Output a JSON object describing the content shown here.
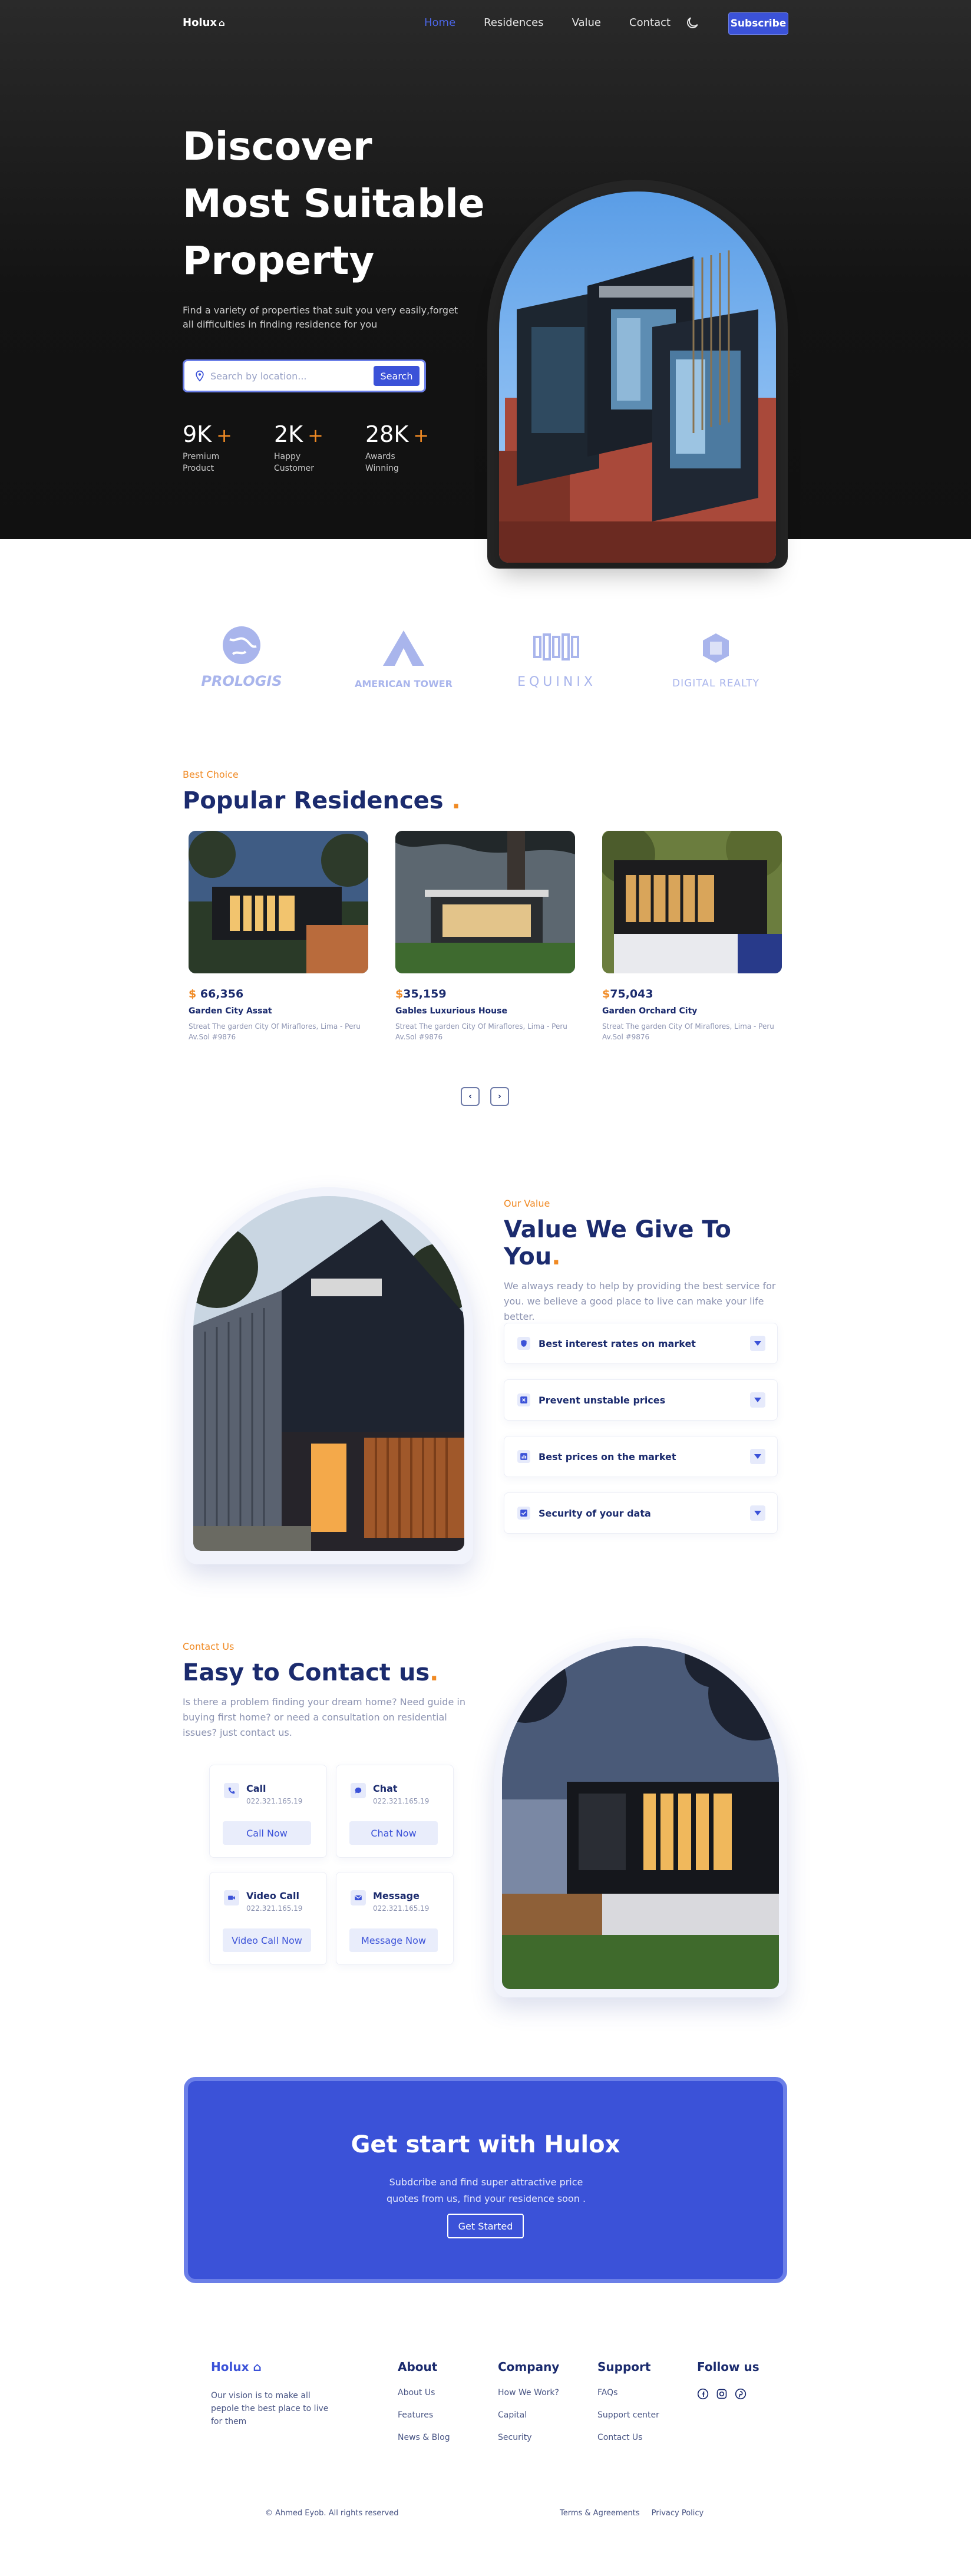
{
  "nav": {
    "logo": "Holux",
    "links": [
      "Home",
      "Residences",
      "Value",
      "Contact"
    ],
    "subscribe": "Subscribe"
  },
  "hero": {
    "title_lines": [
      "Discover",
      "Most Suitable",
      "Property"
    ],
    "subtitle": "Find a variety of properties that suit you very easily,forget all difficulties in finding residence for you",
    "search_placeholder": "Search by location...",
    "search_button": "Search",
    "stats": [
      {
        "value": "9K",
        "label": "Premium Product"
      },
      {
        "value": "2K",
        "label": "Happy Customer"
      },
      {
        "value": "28K",
        "label": "Awards Winning"
      }
    ],
    "plus": "+"
  },
  "partners": [
    "PROLOGIS",
    "AMERICAN TOWER",
    "EQUINIX",
    "DIGITAL REALTY"
  ],
  "popular": {
    "eyebrow": "Best Choice",
    "title": "Popular Residences",
    "title_dot": ".",
    "cards": [
      {
        "currency": "$",
        "price": "66,356",
        "name": "Garden City Assat",
        "address": "Streat The garden City Of Miraflores, Lima - Peru Av.Sol #9876"
      },
      {
        "currency": "$",
        "price": "35,159",
        "name": "Gables Luxurious House",
        "address": "Streat The garden City Of Miraflores, Lima - Peru Av.Sol #9876"
      },
      {
        "currency": "$",
        "price": "75,043",
        "name": "Garden Orchard City",
        "address": "Streat The garden City Of Miraflores, Lima - Peru Av.Sol #9876"
      }
    ],
    "prev": "‹",
    "next": "›"
  },
  "value": {
    "eyebrow": "Our Value",
    "title": "Value We Give To You",
    "title_dot": ".",
    "description": "We always ready to help by providing the best service for you. we believe a good place to live can make your life better.",
    "items": [
      {
        "label": "Best interest rates on market",
        "icon": "shield-icon"
      },
      {
        "label": "Prevent unstable prices",
        "icon": "cancel-icon"
      },
      {
        "label": "Best prices on the market",
        "icon": "analytics-icon"
      },
      {
        "label": "Security of your data",
        "icon": "check-icon"
      }
    ]
  },
  "contact": {
    "eyebrow": "Contact Us",
    "title": "Easy to Contact us",
    "title_dot": ".",
    "description": "Is there a problem finding your dream home? Need guide in buying first home? or need a consultation on residential issues? just contact us.",
    "cards": [
      {
        "title": "Call",
        "number": "022.321.165.19",
        "button": "Call Now",
        "icon": "phone-icon"
      },
      {
        "title": "Chat",
        "number": "022.321.165.19",
        "button": "Chat Now",
        "icon": "chat-icon"
      },
      {
        "title": "Video Call",
        "number": "022.321.165.19",
        "button": "Video Call Now",
        "icon": "video-icon"
      },
      {
        "title": "Message",
        "number": "022.321.165.19",
        "button": "Message Now",
        "icon": "mail-icon"
      }
    ]
  },
  "cta": {
    "title": "Get start with Hulox",
    "subtitle": "Subdcribe and find super attractive price quotes from us, find your residence soon .",
    "button": "Get Started"
  },
  "footer": {
    "logo": "Holux",
    "tagline": "Our vision is to make all pepole the best place to live for them",
    "columns": [
      {
        "title": "About",
        "links": [
          "About Us",
          "Features",
          "News & Blog"
        ]
      },
      {
        "title": "Company",
        "links": [
          "How We Work?",
          "Capital",
          "Security"
        ]
      },
      {
        "title": "Support",
        "links": [
          "FAQs",
          "Support center",
          "Contact Us"
        ]
      }
    ],
    "follow_title": "Follow us",
    "copyright": "© Ahmed Eyob. All rights reserved",
    "legal": [
      "Terms & Agreements",
      "Privacy Policy"
    ]
  },
  "colors": {
    "primary": "#3b52d8",
    "accent": "#f08a24",
    "navy": "#1b2b6e",
    "hero_bg": "#131313"
  }
}
